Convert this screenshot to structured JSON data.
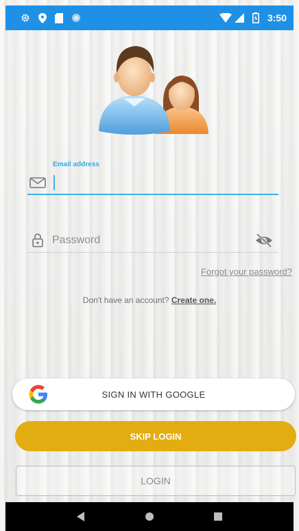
{
  "status_bar": {
    "time": "3:50",
    "icons": [
      "settings-icon",
      "location-icon",
      "sd-card-icon",
      "sync-icon",
      "wifi-icon",
      "signal-icon",
      "battery-icon"
    ]
  },
  "login_form": {
    "email_label": "Email address",
    "email_value": "",
    "password_placeholder": "Password",
    "forgot_password": "Forgot your password?",
    "no_account_text": "Don't have an account? ",
    "create_account": "Create one."
  },
  "buttons": {
    "google": "SIGN IN WITH GOOGLE",
    "skip": "SKIP LOGIN",
    "login": "LOGIN"
  },
  "colors": {
    "status_bar": "#1e90e6",
    "accent": "#37b3e6",
    "skip_button": "#e3ac10"
  }
}
